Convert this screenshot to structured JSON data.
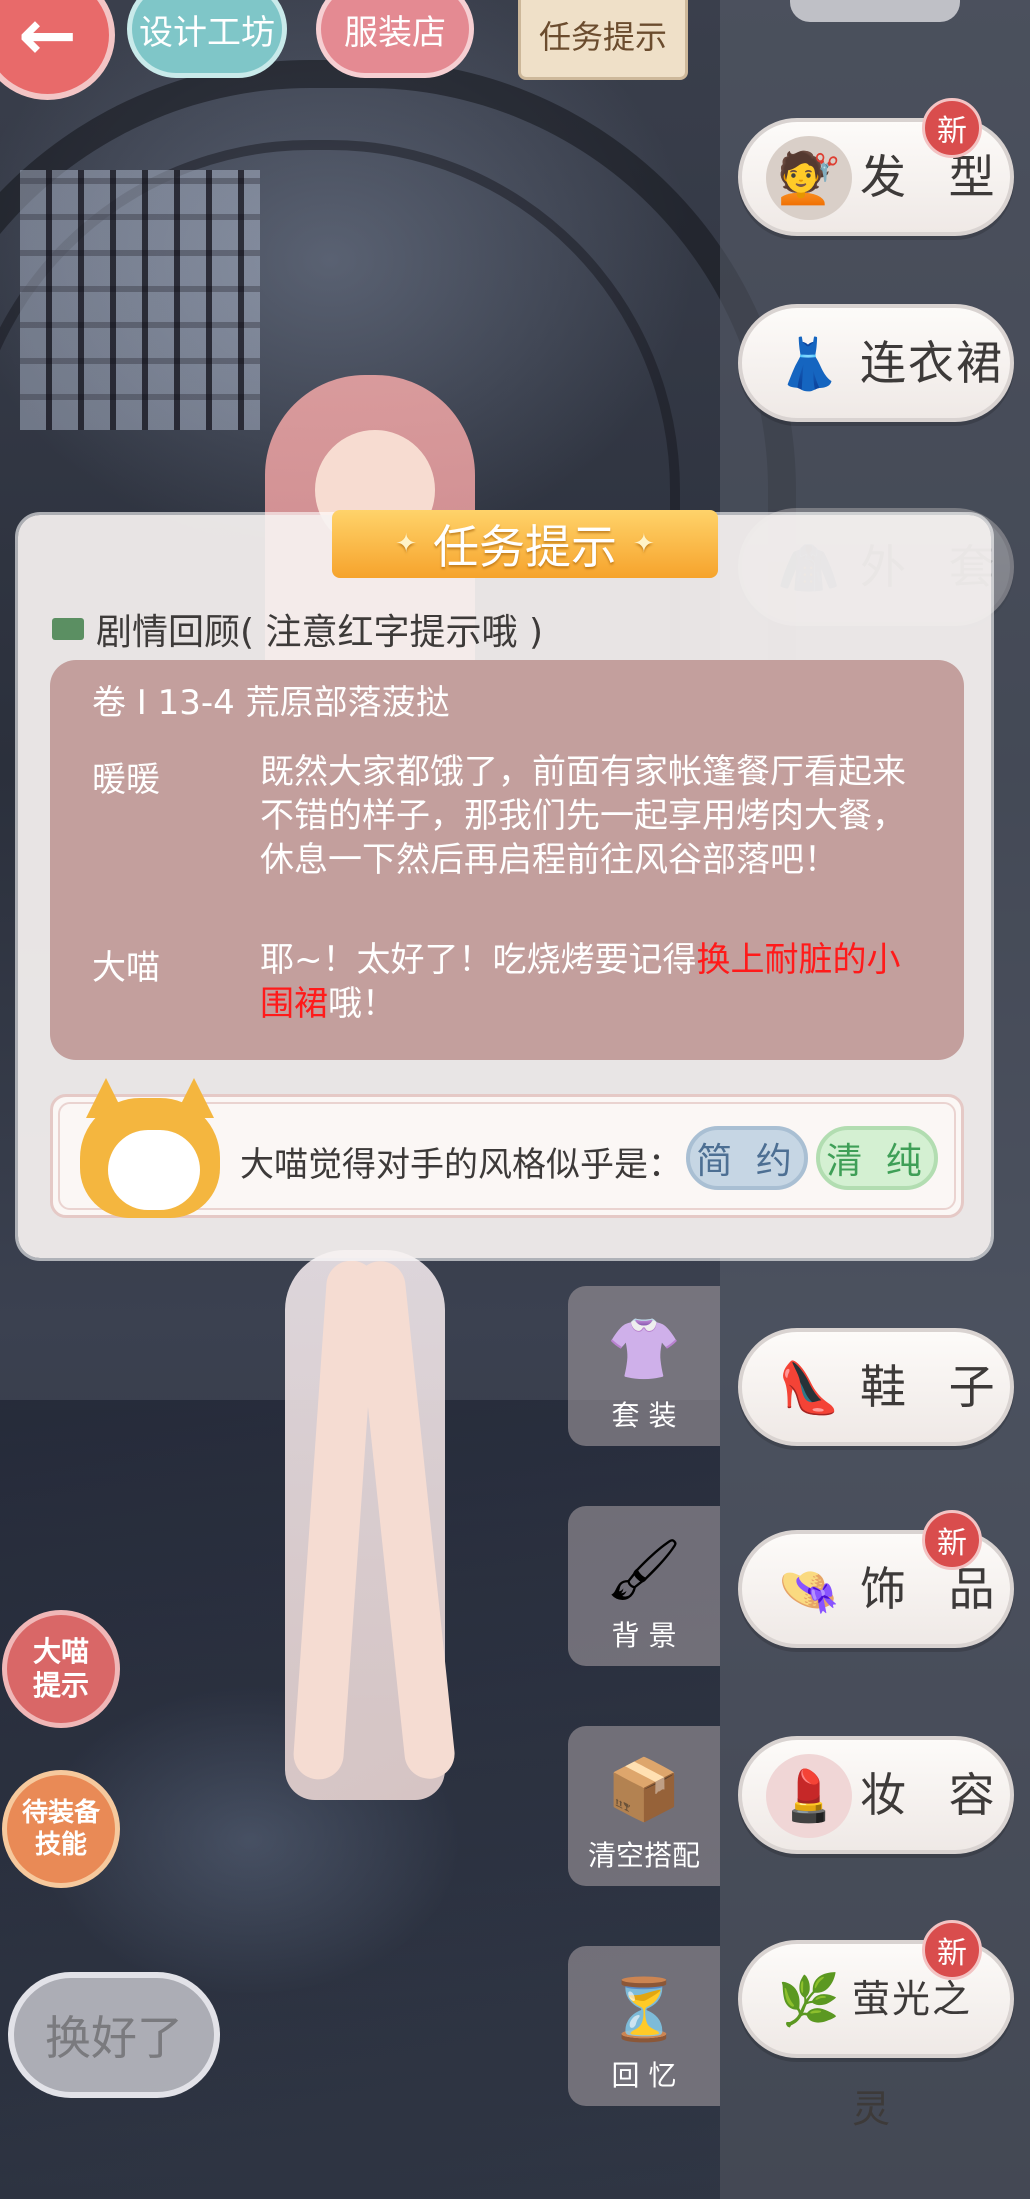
{
  "top_bar": {
    "back_icon": "←",
    "design_workshop": "设计工坊",
    "clothing_store": "服装店",
    "task_hint_tab": "任务提示"
  },
  "categories": [
    {
      "label": "发 型",
      "icon": "hair-icon",
      "badge": "新"
    },
    {
      "label": "连衣裙",
      "icon": "dress-icon",
      "badge": ""
    },
    {
      "label": "外 套",
      "icon": "coat-icon",
      "badge": ""
    },
    {
      "label": "鞋 子",
      "icon": "shoes-icon",
      "badge": ""
    },
    {
      "label": "饰 品",
      "icon": "hat-icon",
      "badge": "新"
    },
    {
      "label": "妆 容",
      "icon": "makeup-icon",
      "badge": ""
    },
    {
      "label": "萤光之灵",
      "icon": "branch-icon",
      "badge": "新"
    }
  ],
  "side_tools": [
    {
      "label": "套 装",
      "icon": "outfit-icon"
    },
    {
      "label": "背 景",
      "icon": "brush-icon"
    },
    {
      "label": "清空搭配",
      "icon": "box-icon"
    },
    {
      "label": "回 忆",
      "icon": "hourglass-icon"
    }
  ],
  "left_buttons": {
    "hint": "大喵\n提示",
    "skill": "待装备\n技能",
    "done": "换好了"
  },
  "dialog": {
    "title": "任务提示",
    "recap_label": "剧情回顾",
    "recap_note": "( 注意红字提示哦 )",
    "chapter": "卷 I 13-4 荒原部落菠挞",
    "lines": [
      {
        "speaker": "暖暖",
        "text": "既然大家都饿了，前面有家帐篷餐厅看起来不错的样子，那我们先一起享用烤肉大餐，休息一下然后再启程前往风谷部落吧！"
      },
      {
        "speaker": "大喵",
        "text_before": "耶~！太好了！吃烧烤要记得",
        "highlight": "换上耐脏的小围裙",
        "text_after": "哦！"
      }
    ],
    "opponent_text": "大喵觉得对手的风格似乎是：",
    "styles": [
      "简 约",
      "清 纯"
    ]
  },
  "colors": {
    "title_bar": "#f6a32c",
    "story_bg": "#c39f9d",
    "highlight": "#ff1a1a",
    "tag_simple": "#4d6f93",
    "tag_pure": "#3f9f57"
  }
}
